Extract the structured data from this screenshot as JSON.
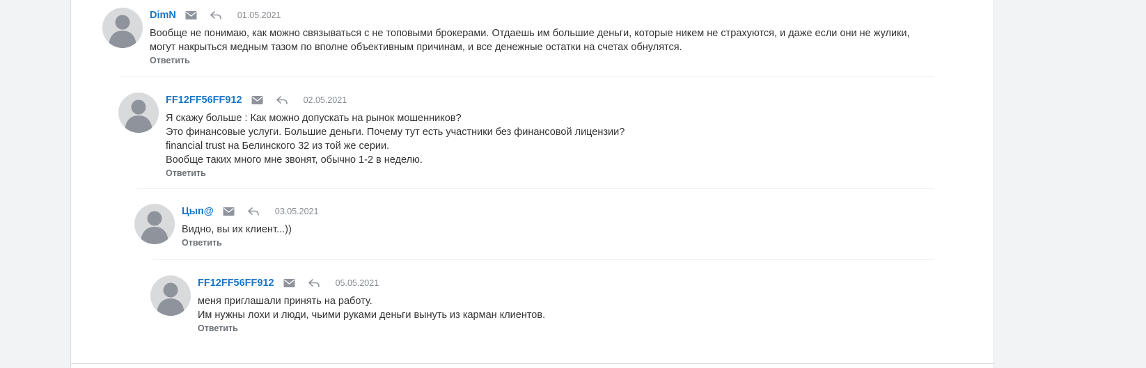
{
  "comments": [
    {
      "author": "DimN",
      "date": "01.05.2021",
      "lines": [
        "Вообще не понимаю, как можно связываться с не топовыми брокерами. Отдаешь им большие деньги, которые никем не страхуются, и даже если они не жулики,",
        "могут накрыться медным тазом по вполне объективным причинам, и все денежные остатки на счетах обнулятся."
      ],
      "reply_label": "Ответить"
    },
    {
      "author": "FF12FF56FF912",
      "date": "02.05.2021",
      "lines": [
        "Я скажу больше : Как можно допускать на рынок мошенников?",
        "Это финансовые услуги. Большие деньги. Почему тут есть участники без финансовой лицензии?",
        "financial trust на Белинского 32 из той же серии.",
        "Вообще таких много мне звонят, обычно 1-2 в неделю."
      ],
      "reply_label": "Ответить"
    },
    {
      "author": "Цып@",
      "date": "03.05.2021",
      "lines": [
        "Видно, вы их клиент...))"
      ],
      "reply_label": "Ответить"
    },
    {
      "author": "FF12FF56FF912",
      "date": "05.05.2021",
      "lines": [
        "меня приглашали принять на работу.",
        "Им нужны лохи и люди, чьими руками деньги вынуть из карман клиентов."
      ],
      "reply_label": "Ответить"
    }
  ],
  "icons": {
    "avatar": "default-user-avatar-icon",
    "mail": "envelope-icon",
    "reply": "reply-arrow-icon"
  },
  "colors": {
    "author_link": "#1976c7",
    "date": "#858a90",
    "reply_link": "#6b7075",
    "avatar_bg": "#d9dadc",
    "avatar_figure": "#8f949c"
  }
}
